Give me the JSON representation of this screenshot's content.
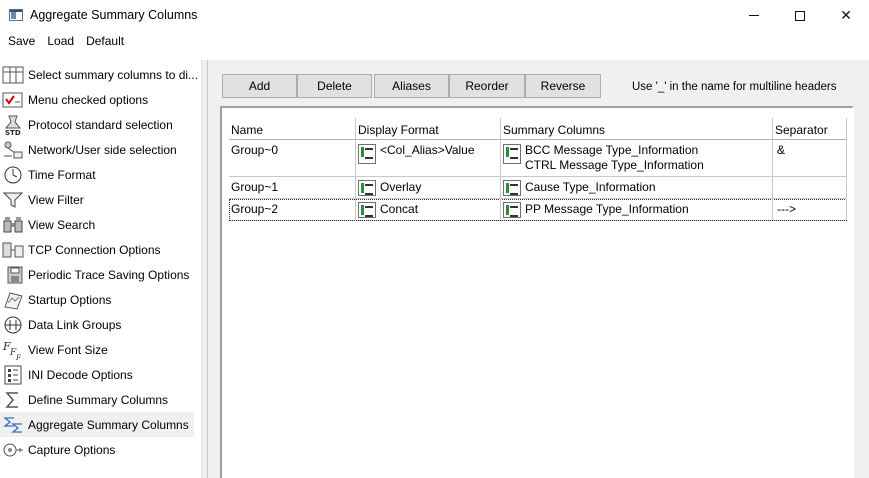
{
  "window": {
    "title": "Aggregate Summary Columns",
    "minimize_glyph": "—",
    "close_glyph": "✕"
  },
  "menu": [
    "Save",
    "Load",
    "Default"
  ],
  "tree": [
    {
      "label": "Select summary columns to di...",
      "icon": "column-select-icon"
    },
    {
      "label": "Menu checked options",
      "icon": "checked-menu-icon"
    },
    {
      "label": "Protocol standard selection",
      "icon": "protocol-std-icon"
    },
    {
      "label": "Network/User side selection",
      "icon": "network-user-icon"
    },
    {
      "label": "Time Format",
      "icon": "clock-icon"
    },
    {
      "label": "View Filter",
      "icon": "filter-funnel-icon"
    },
    {
      "label": "View Search",
      "icon": "binoculars-icon"
    },
    {
      "label": "TCP Connection Options",
      "icon": "tcp-connection-icon"
    },
    {
      "label": "Periodic Trace Saving Options",
      "icon": "periodic-save-icon"
    },
    {
      "label": "Startup Options",
      "icon": "startup-icon"
    },
    {
      "label": "Data Link Groups",
      "icon": "data-link-icon"
    },
    {
      "label": "View Font Size",
      "icon": "font-size-icon"
    },
    {
      "label": "INI Decode Options",
      "icon": "ini-decode-icon"
    },
    {
      "label": "Define Summary Columns",
      "icon": "sigma-icon"
    },
    {
      "label": "Aggregate Summary Columns",
      "icon": "aggregate-icon"
    },
    {
      "label": "Capture Options",
      "icon": "capture-icon"
    }
  ],
  "toolbar": {
    "add": "Add",
    "delete": "Delete",
    "aliases": "Aliases",
    "reorder": "Reorder",
    "reverse": "Reverse",
    "hint": "Use '_' in the name for multiline headers"
  },
  "grid": {
    "headers": [
      "Name",
      "Display Format",
      "Summary Columns",
      "Separator"
    ],
    "rows": [
      {
        "name": "Group~0",
        "format": "<Col_Alias>Value",
        "columns": [
          "BCC Message Type_Information",
          "CTRL Message Type_Information"
        ],
        "separator": "&"
      },
      {
        "name": "Group~1",
        "format": "Overlay",
        "columns": [
          "Cause Type_Information"
        ],
        "separator": ""
      },
      {
        "name": "Group~2",
        "format": "Concat",
        "columns": [
          "PP Message Type_Information"
        ],
        "separator": "--->"
      }
    ]
  }
}
